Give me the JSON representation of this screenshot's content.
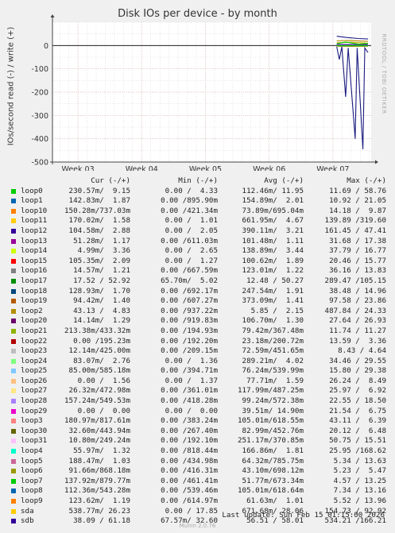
{
  "colors": {
    "bg": "#f0f0f0",
    "grid_major": "#e2b9b9",
    "grid_minor": "#d6d6d6",
    "axis": "#444444"
  },
  "chart_data": {
    "type": "line",
    "title": "Disk IOs per device - by month",
    "ylabel": "IOs/second read (-) / write (+)",
    "side_label": "RRDTOOL / TOBI OETIKER",
    "xticks": [
      "Week 03",
      "Week 04",
      "Week 05",
      "Week 06",
      "Week 07"
    ],
    "yticks": [
      0,
      -100,
      -200,
      -300,
      -400,
      -500
    ],
    "ylim": [
      -500,
      100
    ],
    "x_range_weeks": [
      2.6,
      7.6
    ],
    "series_plotted": [
      {
        "name": "sdb",
        "color": "#1a1a80",
        "write": [
          [
            7.06,
            40
          ],
          [
            7.2,
            35
          ],
          [
            7.4,
            30
          ],
          [
            7.55,
            28
          ]
        ],
        "read": [
          [
            7.06,
            -5
          ],
          [
            7.1,
            -60
          ],
          [
            7.14,
            -5
          ],
          [
            7.2,
            -220
          ],
          [
            7.24,
            -10
          ],
          [
            7.35,
            -400
          ],
          [
            7.38,
            -10
          ],
          [
            7.47,
            -445
          ],
          [
            7.5,
            -10
          ],
          [
            7.55,
            -30
          ]
        ]
      },
      {
        "name": "sda",
        "color": "#ccaa00",
        "write": [
          [
            7.06,
            12
          ],
          [
            7.3,
            14
          ],
          [
            7.55,
            10
          ]
        ],
        "read": [
          [
            7.06,
            -3
          ],
          [
            7.3,
            -4
          ],
          [
            7.55,
            -3
          ]
        ]
      },
      {
        "name": "loop2",
        "color": "#b48200",
        "write": [
          [
            7.06,
            20
          ],
          [
            7.25,
            22
          ],
          [
            7.55,
            18
          ]
        ],
        "read": [
          [
            7.06,
            -2
          ],
          [
            7.55,
            -2
          ]
        ]
      },
      {
        "name": "loop12",
        "color": "#330099",
        "write": [
          [
            7.06,
            5
          ],
          [
            7.55,
            4
          ]
        ],
        "read": [
          [
            7.06,
            -1
          ],
          [
            7.55,
            -1
          ]
        ]
      },
      {
        "name": "loop16",
        "color": "#00cc00",
        "write": [
          [
            7.06,
            8
          ],
          [
            7.2,
            15
          ],
          [
            7.4,
            6
          ],
          [
            7.55,
            9
          ]
        ],
        "read": [
          [
            7.06,
            -1
          ],
          [
            7.55,
            -1
          ]
        ]
      }
    ]
  },
  "legend": {
    "headers": {
      "cur": "Cur (-/+)",
      "min": "Min (-/+)",
      "avg": "Avg (-/+)",
      "max": "Max (-/+)"
    },
    "rows": [
      {
        "name": "loop0",
        "color": "#00cc00",
        "cur": "230.57m/  9.15",
        "min": "0.00 /  4.33",
        "avg": "112.46m/ 11.95",
        "max": "11.69 / 58.76"
      },
      {
        "name": "loop1",
        "color": "#0066b3",
        "cur": "142.83m/  1.87",
        "min": "0.00 /895.90m",
        "avg": "154.89m/  2.01",
        "max": "10.92 / 21.05"
      },
      {
        "name": "loop10",
        "color": "#ff8000",
        "cur": "150.28m/737.03m",
        "min": "0.00 /421.34m",
        "avg": "73.89m/695.04m",
        "max": "14.18 /  9.87"
      },
      {
        "name": "loop11",
        "color": "#ffcc00",
        "cur": "170.02m/  1.58",
        "min": "0.00 /  1.01",
        "avg": "661.95m/  4.67",
        "max": "139.89 /319.60"
      },
      {
        "name": "loop12",
        "color": "#330099",
        "cur": "104.58m/  2.88",
        "min": "0.00 /  2.05",
        "avg": "390.11m/  3.21",
        "max": "161.45 / 47.41"
      },
      {
        "name": "loop13",
        "color": "#990099",
        "cur": "51.28m/  1.17",
        "min": "0.00 /611.03m",
        "avg": "101.48m/  1.11",
        "max": "31.68 / 17.38"
      },
      {
        "name": "loop14",
        "color": "#ccff00",
        "cur": "4.99m/  3.36",
        "min": "0.00 /  2.65",
        "avg": "138.89m/  3.44",
        "max": "37.79 / 16.77"
      },
      {
        "name": "loop15",
        "color": "#ff0000",
        "cur": "105.35m/  2.09",
        "min": "0.00 /  1.27",
        "avg": "100.62m/  1.89",
        "max": "20.46 / 15.77"
      },
      {
        "name": "loop16",
        "color": "#808080",
        "cur": "14.57m/  1.21",
        "min": "0.00 /667.59m",
        "avg": "123.01m/  1.22",
        "max": "36.16 / 13.83"
      },
      {
        "name": "loop17",
        "color": "#008f00",
        "cur": "17.52 / 52.92",
        "min": "65.70m/  5.02",
        "avg": "12.48 / 50.27",
        "max": "289.47 /105.15"
      },
      {
        "name": "loop18",
        "color": "#00487d",
        "cur": "128.93m/  1.70",
        "min": "0.00 /692.17m",
        "avg": "247.54m/  1.91",
        "max": "38.48 / 14.96"
      },
      {
        "name": "loop19",
        "color": "#b35a00",
        "cur": "94.42m/  1.40",
        "min": "0.00 /607.27m",
        "avg": "373.09m/  1.41",
        "max": "97.58 / 23.86"
      },
      {
        "name": "loop2",
        "color": "#b38f00",
        "cur": "43.13 /  4.83",
        "min": "0.00 /937.22m",
        "avg": "5.85 /  2.15",
        "max": "487.84 / 24.33"
      },
      {
        "name": "loop20",
        "color": "#6b006b",
        "cur": "14.14m/  1.29",
        "min": "0.00 /919.83m",
        "avg": "106.70m/  1.30",
        "max": "27.64 / 26.93"
      },
      {
        "name": "loop21",
        "color": "#8fb300",
        "cur": "213.38m/433.32m",
        "min": "0.00 /194.93m",
        "avg": "79.42m/367.48m",
        "max": "11.74 / 11.27"
      },
      {
        "name": "loop22",
        "color": "#b30000",
        "cur": "0.00 /195.23m",
        "min": "0.00 /192.20m",
        "avg": "23.18m/200.72m",
        "max": "13.59 /  3.36"
      },
      {
        "name": "loop23",
        "color": "#bebebe",
        "cur": "12.14m/425.00m",
        "min": "0.00 /209.15m",
        "avg": "72.59m/451.65m",
        "max": "8.43 / 4.64"
      },
      {
        "name": "loop24",
        "color": "#80ff80",
        "cur": "83.07m/  2.76",
        "min": "0.00 /  1.36",
        "avg": "289.21m/  4.02",
        "max": "34.46 / 29.55"
      },
      {
        "name": "loop25",
        "color": "#80c9ff",
        "cur": "85.00m/585.18m",
        "min": "0.00 /394.71m",
        "avg": "76.24m/539.99m",
        "max": "15.80 / 29.38"
      },
      {
        "name": "loop26",
        "color": "#ffc080",
        "cur": "0.00 /  1.56",
        "min": "0.00 /  1.37",
        "avg": "77.71m/  1.59",
        "max": "26.24 /  8.49"
      },
      {
        "name": "loop27",
        "color": "#ffe680",
        "cur": "26.32m/472.98m",
        "min": "0.00 /361.01m",
        "avg": "117.99m/487.25m",
        "max": "25.97 /  6.92"
      },
      {
        "name": "loop28",
        "color": "#aa80ff",
        "cur": "157.24m/549.53m",
        "min": "0.00 /418.28m",
        "avg": "99.24m/572.38m",
        "max": "22.55 / 18.50"
      },
      {
        "name": "loop29",
        "color": "#ee00cc",
        "cur": "0.00 /  0.00",
        "min": "0.00 /  0.00",
        "avg": "39.51m/ 14.90m",
        "max": "21.54 /  6.75"
      },
      {
        "name": "loop3",
        "color": "#ff8080",
        "cur": "180.97m/817.61m",
        "min": "0.00 /383.24m",
        "avg": "105.01m/618.55m",
        "max": "43.11 /  6.39"
      },
      {
        "name": "loop30",
        "color": "#666600",
        "cur": "32.60m/443.94m",
        "min": "0.00 /267.40m",
        "avg": "82.99m/452.76m",
        "max": "20.12 /  6.48"
      },
      {
        "name": "loop31",
        "color": "#ffbfff",
        "cur": "10.80m/249.24m",
        "min": "0.00 /192.10m",
        "avg": "251.17m/370.85m",
        "max": "50.75 / 15.51"
      },
      {
        "name": "loop4",
        "color": "#00ffcc",
        "cur": "55.97m/  1.32",
        "min": "0.00 /818.44m",
        "avg": "166.86m/  1.81",
        "max": "25.95 /168.62"
      },
      {
        "name": "loop5",
        "color": "#cc6699",
        "cur": "188.47m/  1.03",
        "min": "0.00 /434.98m",
        "avg": "64.32m/785.75m",
        "max": "5.34 / 13.63"
      },
      {
        "name": "loop6",
        "color": "#999900",
        "cur": "91.66m/868.18m",
        "min": "0.00 /416.31m",
        "avg": "43.10m/698.12m",
        "max": "5.23 /  5.47"
      },
      {
        "name": "loop7",
        "color": "#00cc00",
        "cur": "137.92m/879.77m",
        "min": "0.00 /461.41m",
        "avg": "51.77m/673.34m",
        "max": "4.57 / 13.25"
      },
      {
        "name": "loop8",
        "color": "#0066b3",
        "cur": "112.36m/543.28m",
        "min": "0.00 /539.46m",
        "avg": "105.01m/618.64m",
        "max": "7.34 / 13.16"
      },
      {
        "name": "loop9",
        "color": "#ff8000",
        "cur": "123.62m/  1.19",
        "min": "0.00 /614.97m",
        "avg": "61.63m/  1.01",
        "max": "5.52 / 13.96"
      },
      {
        "name": "sda",
        "color": "#ffcc00",
        "cur": "538.77m/ 26.23",
        "min": "0.00 / 17.85",
        "avg": "671.68m/ 28.06",
        "max": "154.73 / 92.92"
      },
      {
        "name": "sdb",
        "color": "#330099",
        "cur": "38.09 / 61.18",
        "min": "67.57m/ 32.60",
        "avg": "56.51 / 58.01",
        "max": "534.21 /166.21"
      }
    ]
  },
  "footer": {
    "last_update": "Last update: Sun Feb 15 01:15:00 2026",
    "version": "Munin 2.0.76"
  }
}
